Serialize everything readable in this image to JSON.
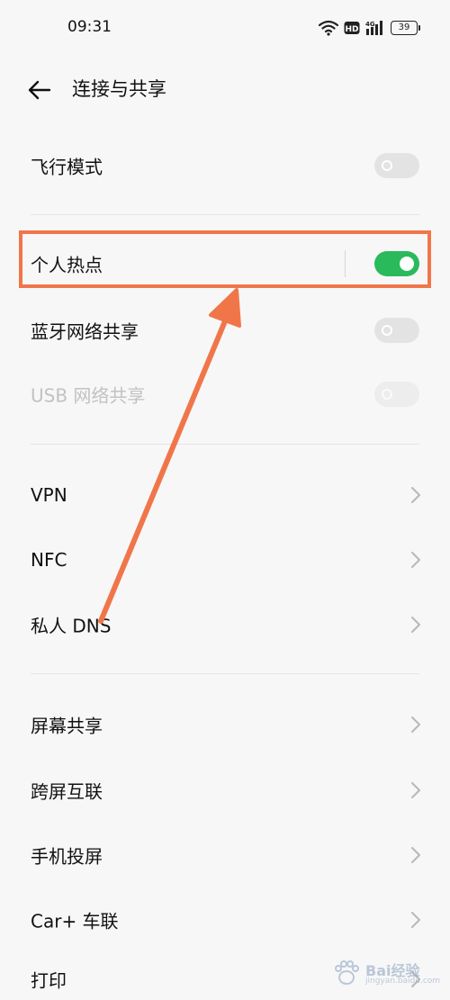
{
  "status_bar": {
    "time": "09:31",
    "battery": "39",
    "icons": [
      "wifi-icon",
      "hd-icon",
      "4g-signal-icon",
      "battery-icon"
    ]
  },
  "header": {
    "title": "连接与共享",
    "back_icon": "arrow-left-icon"
  },
  "rows": [
    {
      "id": "airplane",
      "label": "飞行模式",
      "type": "toggle",
      "on": false
    },
    {
      "id": "hotspot",
      "label": "个人热点",
      "type": "toggle",
      "on": true
    },
    {
      "id": "bt-tether",
      "label": "蓝牙网络共享",
      "type": "toggle",
      "on": false
    },
    {
      "id": "usb-tether",
      "label": "USB 网络共享",
      "type": "toggle",
      "on": false,
      "disabled": true
    },
    {
      "id": "vpn",
      "label": "VPN",
      "type": "link"
    },
    {
      "id": "nfc",
      "label": "NFC",
      "type": "link"
    },
    {
      "id": "private-dns",
      "label": "私人 DNS",
      "type": "link"
    },
    {
      "id": "screen-share",
      "label": "屏幕共享",
      "type": "link"
    },
    {
      "id": "cross-screen",
      "label": "跨屏互联",
      "type": "link"
    },
    {
      "id": "screen-cast",
      "label": "手机投屏",
      "type": "link"
    },
    {
      "id": "carplus",
      "label": "Car+ 车联",
      "type": "link"
    },
    {
      "id": "print",
      "label": "打印",
      "type": "link"
    }
  ],
  "colors": {
    "toggle_on": "#2aba5c",
    "toggle_off": "#e3e3e3",
    "annotation": "#f0764a"
  },
  "watermark": {
    "text": "Bai经验",
    "sub": "jingyan.baidu.com"
  }
}
